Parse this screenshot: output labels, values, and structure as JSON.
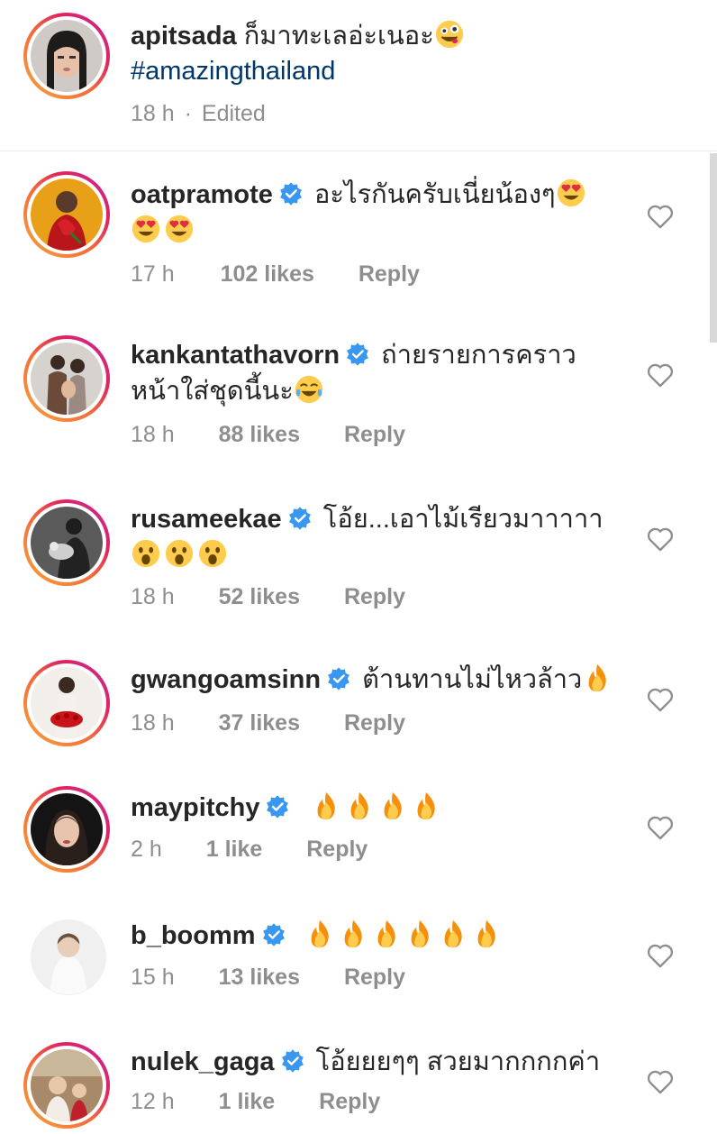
{
  "caption": {
    "username": "apitsada",
    "text": "ก็มาทะเลอ่ะเนอะ",
    "emoji": "zany-face",
    "hashtag": "#amazingthailand",
    "time": "18 h",
    "separator": "·",
    "edited": "Edited"
  },
  "comments": [
    {
      "username": "oatpramote",
      "verified": true,
      "text_line1": "อะไรกันครับเนี่ยน้องๆ",
      "text_line2": "",
      "emojis": [
        "heart-eyes",
        "heart-eyes",
        "heart-eyes"
      ],
      "time": "17 h",
      "likes": "102 likes",
      "reply": "Reply"
    },
    {
      "username": "kankantathavorn",
      "verified": true,
      "text_line1": "ถ่ายรายการคราว",
      "text_line2": "หน้าใส่ชุดนี้นะ",
      "emojis": [
        "tears-of-joy"
      ],
      "time": "18 h",
      "likes": "88 likes",
      "reply": "Reply"
    },
    {
      "username": "rusameekae",
      "verified": true,
      "text_line1": "โอ้ย...เอาไม้เรียวมาาาาา",
      "text_line2": "",
      "emojis": [
        "open-mouth",
        "open-mouth",
        "open-mouth"
      ],
      "time": "18 h",
      "likes": "52 likes",
      "reply": "Reply"
    },
    {
      "username": "gwangoamsinn",
      "verified": true,
      "text_line1": "ต้านทานไม่ไหวล้าว",
      "text_line2": "",
      "emojis": [
        "fire"
      ],
      "time": "18 h",
      "likes": "37 likes",
      "reply": "Reply"
    },
    {
      "username": "maypitchy",
      "verified": true,
      "text_line1": "",
      "text_line2": "",
      "emojis": [
        "fire",
        "fire",
        "fire",
        "fire"
      ],
      "time": "2 h",
      "likes": "1 like",
      "reply": "Reply"
    },
    {
      "username": "b_boomm",
      "verified": true,
      "text_line1": "",
      "text_line2": "",
      "emojis": [
        "fire",
        "fire",
        "fire",
        "fire",
        "fire",
        "fire"
      ],
      "time": "15 h",
      "likes": "13 likes",
      "reply": "Reply"
    },
    {
      "username": "nulek_gaga",
      "verified": true,
      "text_line1": "โอ้ยยยๆๆ สวยมากกกกค่า",
      "text_line2": "",
      "emojis": [],
      "time": "12 h",
      "likes": "1 like",
      "reply": "Reply"
    }
  ],
  "colors": {
    "text": "#262626",
    "muted": "#8e8e8e",
    "hashtag": "#00376b",
    "verified": "#3897f0"
  },
  "icons": [
    "verified-badge-icon",
    "heart-outline-icon",
    "avatar"
  ]
}
